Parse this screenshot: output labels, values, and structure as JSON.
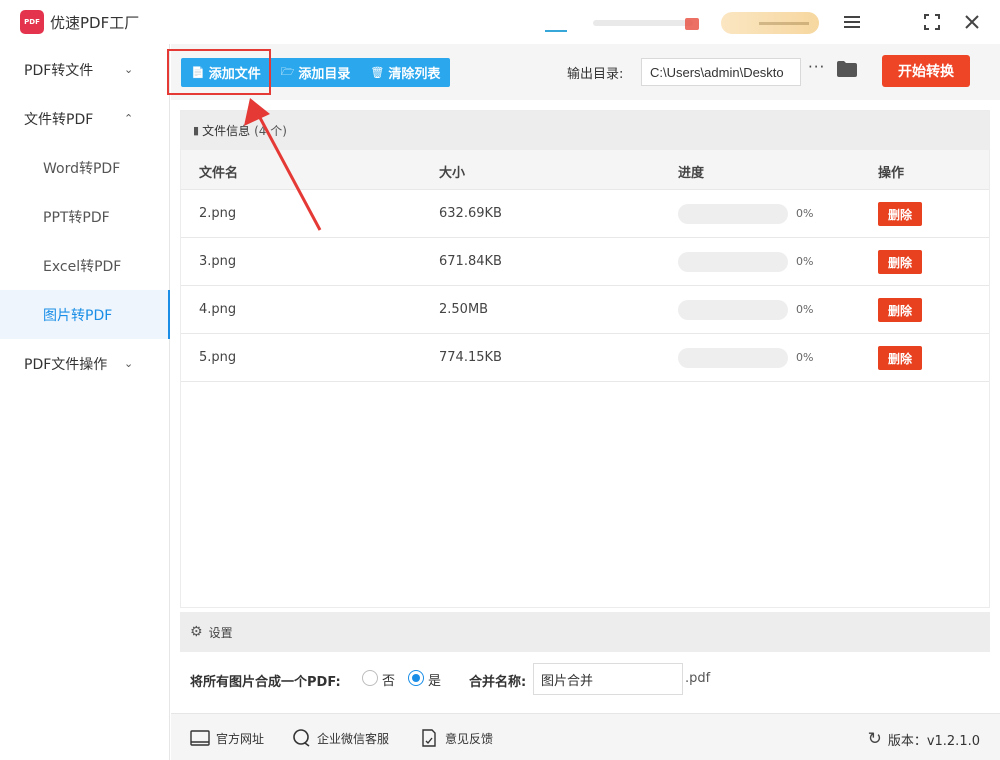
{
  "app": {
    "title": "优速PDF工厂",
    "logo_text": "PDF"
  },
  "window": {
    "menu_icon": "menu-icon",
    "maximize_icon": "fullscreen-icon",
    "close_icon": "close-icon"
  },
  "sidebar": {
    "items": [
      {
        "label": "PDF转文件",
        "type": "group",
        "expanded": false
      },
      {
        "label": "文件转PDF",
        "type": "group",
        "expanded": true
      },
      {
        "label": "Word转PDF",
        "type": "sub"
      },
      {
        "label": "PPT转PDF",
        "type": "sub"
      },
      {
        "label": "Excel转PDF",
        "type": "sub"
      },
      {
        "label": "图片转PDF",
        "type": "sub",
        "active": true
      },
      {
        "label": "PDF文件操作",
        "type": "group",
        "expanded": false
      }
    ]
  },
  "toolbar": {
    "add_file": "添加文件",
    "add_folder": "添加目录",
    "clear_list": "清除列表",
    "output_label": "输出目录:",
    "output_value": "C:\\Users\\admin\\Deskto",
    "more": "···",
    "start": "开始转换"
  },
  "file_panel": {
    "title": "文件信息",
    "count": "(4 个)",
    "columns": [
      "文件名",
      "大小",
      "进度",
      "操作"
    ],
    "rows": [
      {
        "name": "2.png",
        "size": "632.69KB",
        "progress": "0%",
        "action": "删除"
      },
      {
        "name": "3.png",
        "size": "671.84KB",
        "progress": "0%",
        "action": "删除"
      },
      {
        "name": "4.png",
        "size": "2.50MB",
        "progress": "0%",
        "action": "删除"
      },
      {
        "name": "5.png",
        "size": "774.15KB",
        "progress": "0%",
        "action": "删除"
      }
    ]
  },
  "settings": {
    "title": "设置",
    "merge_label": "将所有图片合成一个PDF:",
    "option_no": "否",
    "option_yes": "是",
    "selected": "是",
    "name_label": "合并名称:",
    "name_value": "图片合并",
    "suffix": ".pdf"
  },
  "footer": {
    "website": "官方网址",
    "wechat": "企业微信客服",
    "feedback": "意见反馈",
    "version": "版本：v1.2.1.0"
  },
  "colors": {
    "accent": "#2ba7ed",
    "danger": "#ee4527",
    "active_blue": "#1a8ee6",
    "highlight": "#e53935"
  }
}
